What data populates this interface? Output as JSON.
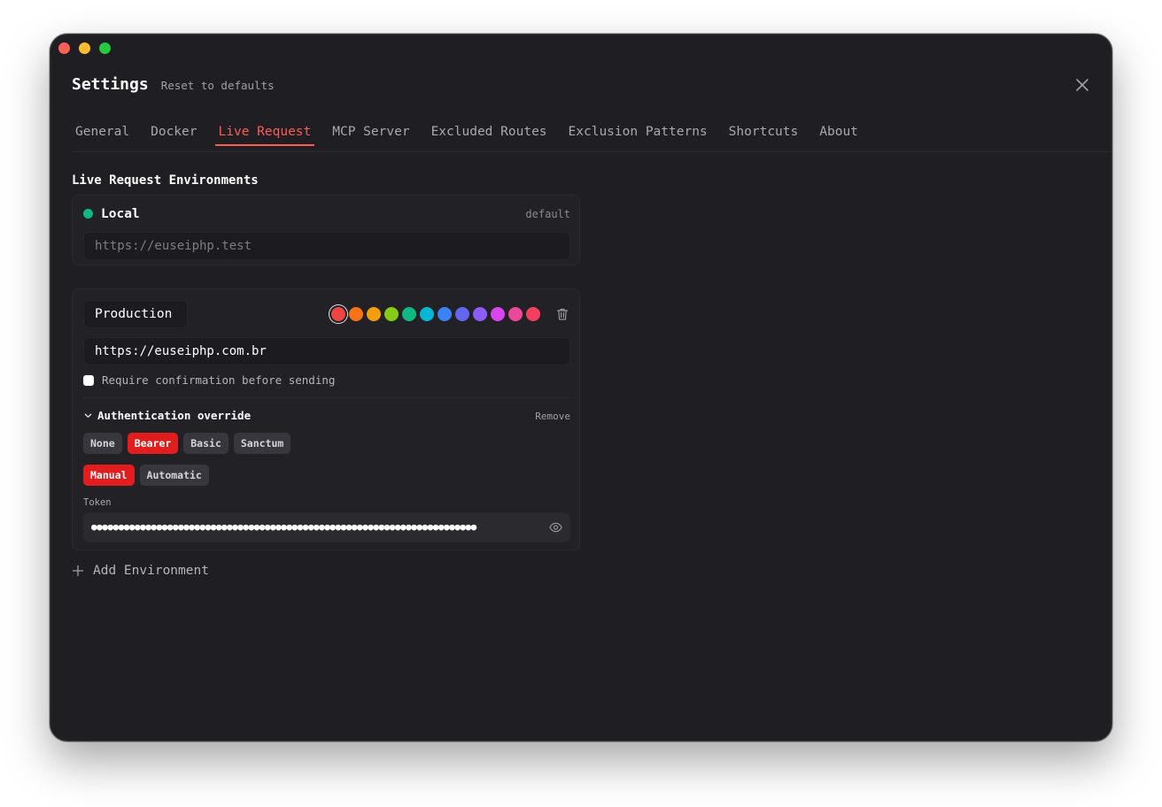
{
  "window": {
    "title": "Settings",
    "reset_label": "Reset to defaults"
  },
  "tabs": [
    {
      "label": "General",
      "active": false
    },
    {
      "label": "Docker",
      "active": false
    },
    {
      "label": "Live Request",
      "active": true
    },
    {
      "label": "MCP Server",
      "active": false
    },
    {
      "label": "Excluded Routes",
      "active": false
    },
    {
      "label": "Exclusion Patterns",
      "active": false
    },
    {
      "label": "Shortcuts",
      "active": false
    },
    {
      "label": "About",
      "active": false
    }
  ],
  "section": {
    "title": "Live Request Environments"
  },
  "local_env": {
    "name": "Local",
    "tag": "default",
    "url_placeholder": "https://euseiphp.test",
    "dot_color": "#10b981"
  },
  "prod_env": {
    "name": "Production",
    "url": "https://euseiphp.com.br",
    "colors": [
      "#ef4444",
      "#f97316",
      "#f59e0b",
      "#84cc16",
      "#10b981",
      "#06b6d4",
      "#3b82f6",
      "#6366f1",
      "#8b5cf6",
      "#d946ef",
      "#ec4899",
      "#f43f5e"
    ],
    "selected_color": "#ef4444",
    "confirm_label": "Require confirmation before sending",
    "confirm_checked": false,
    "auth": {
      "title": "Authentication override",
      "remove_label": "Remove",
      "types": [
        {
          "label": "None",
          "active": false
        },
        {
          "label": "Bearer",
          "active": true
        },
        {
          "label": "Basic",
          "active": false
        },
        {
          "label": "Sanctum",
          "active": false
        }
      ],
      "modes": [
        {
          "label": "Manual",
          "active": true
        },
        {
          "label": "Automatic",
          "active": false
        }
      ],
      "token_label": "Token",
      "token_masked": "●●●●●●●●●●●●●●●●●●●●●●●●●●●●●●●●●●●●●●●●●●●●●●●●●●●●●●●●●●●●●●●●●●●●●●●"
    }
  },
  "add_env_label": "Add Environment",
  "colors": {
    "accent": "#ff5b55",
    "active_pill": "#e11d1d",
    "background": "#1f1f23"
  }
}
